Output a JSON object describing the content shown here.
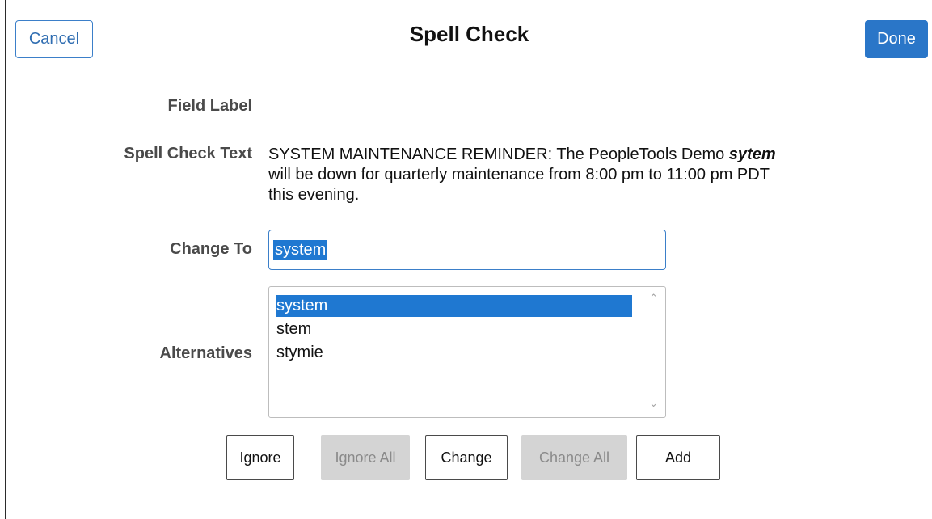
{
  "header": {
    "cancel_label": "Cancel",
    "title": "Spell Check",
    "done_label": "Done"
  },
  "form": {
    "field_label_label": "Field Label",
    "spell_check_text_label": "Spell Check Text",
    "spell_check_text": {
      "line1_before": "SYSTEM MAINTENANCE REMINDER: The PeopleTools Demo ",
      "misspelled_word": "sytem",
      "line2": "will be down for quarterly maintenance from 8:00 pm to 11:00 pm PDT",
      "line3": "this evening."
    },
    "change_to_label": "Change To",
    "change_to_value": "system",
    "alternatives_label": "Alternatives",
    "alternatives": [
      {
        "label": "system",
        "selected": true
      },
      {
        "label": "stem",
        "selected": false
      },
      {
        "label": "stymie",
        "selected": false
      }
    ]
  },
  "actions": {
    "ignore_label": "Ignore",
    "ignore_all_label": "Ignore All",
    "change_label": "Change",
    "change_all_label": "Change All",
    "add_label": "Add"
  },
  "colors": {
    "accent": "#2a76c8",
    "selection": "#1f78d1",
    "disabled_bg": "#d4d4d4"
  }
}
